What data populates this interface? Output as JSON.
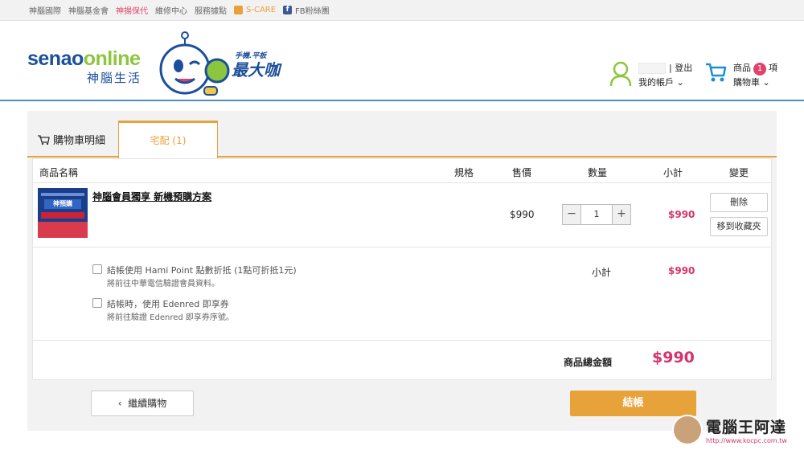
{
  "topbar": {
    "links": [
      "神腦國際",
      "神腦基金會",
      "神揚保代",
      "維修中心",
      "服務據點",
      "S-CARE",
      "FB粉絲團"
    ]
  },
  "header": {
    "logo_brand_a": "senao",
    "logo_brand_b": "online",
    "logo_sub": "神腦生活",
    "mascot_text_small": "手機.平板",
    "mascot_text_big": "最大咖",
    "logout_label": "登出",
    "account_label": "我的帳戶",
    "cart_label_top": "商品",
    "cart_count": "1",
    "cart_unit": "項",
    "cart_label_bottom": "購物車"
  },
  "tabs": {
    "detail_label": "購物車明細",
    "home_delivery_label": "宅配 (1)"
  },
  "table": {
    "headers": {
      "name": "商品名稱",
      "spec": "規格",
      "price": "售價",
      "qty": "數量",
      "subtotal": "小計",
      "change": "變更"
    },
    "item": {
      "name": "神腦會員獨享 新機預購方案",
      "thumb_text": "神預購",
      "price": "$990",
      "qty": "1",
      "subtotal": "$990",
      "delete_label": "刪除",
      "favorite_label": "移到收藏夾"
    }
  },
  "discount": {
    "hami_label": "結帳使用 Hami Point 點數折抵 (1點可折抵1元)",
    "hami_note": "將前往中華電信驗證會員資料。",
    "edenred_label": "結帳時，使用 Edenred 即享券",
    "edenred_note": "將前往驗證 Edenred 即享券序號。",
    "subtotal_label": "小計",
    "subtotal_value": "$990"
  },
  "total": {
    "label": "商品總金額",
    "value": "$990"
  },
  "actions": {
    "continue_label": "繼續購物",
    "checkout_label": "結帳"
  },
  "watermark": {
    "name": "電腦王阿達",
    "url": "http://www.kocpc.com.tw"
  },
  "colors": {
    "accent": "#e8a23a",
    "price": "#d6336c",
    "brand_blue": "#1b4f9b",
    "brand_green": "#8cc63f",
    "badge": "#e0426b"
  }
}
